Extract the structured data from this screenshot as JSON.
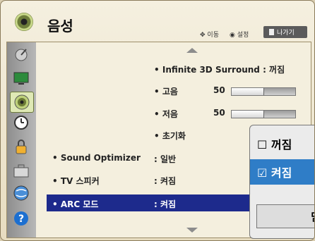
{
  "header": {
    "title": "음성",
    "move_hint": "이동",
    "set_hint": "설정",
    "exit_label": "나가기"
  },
  "sidebar": {
    "items": [
      {
        "icon": "satellite-icon",
        "active": false
      },
      {
        "icon": "monitor-icon",
        "active": false
      },
      {
        "icon": "speaker-icon",
        "active": true
      },
      {
        "icon": "clock-icon",
        "active": false
      },
      {
        "icon": "lock-icon",
        "active": false
      },
      {
        "icon": "toolbox-icon",
        "active": false
      },
      {
        "icon": "network-icon",
        "active": false
      },
      {
        "icon": "help-icon",
        "active": false
      }
    ]
  },
  "menu": {
    "surround": "• Infinite 3D Surround : 꺼짐",
    "treble_label": "• 고음",
    "treble_value": "50",
    "treble_level": 0.5,
    "bass_label": "• 저음",
    "bass_value": "50",
    "bass_level": 0.5,
    "reset": "• 초기화",
    "sound_optimizer_label": "• Sound Optimizer",
    "sound_optimizer_value": ": 일반",
    "tv_speaker_label": "• TV 스피커",
    "tv_speaker_value": ": 켜짐",
    "arc_label": "• ARC 모드",
    "arc_value": ": 켜짐"
  },
  "popup": {
    "off": "☐ 꺼짐",
    "on": "☑ 켜짐",
    "close": "닫"
  }
}
